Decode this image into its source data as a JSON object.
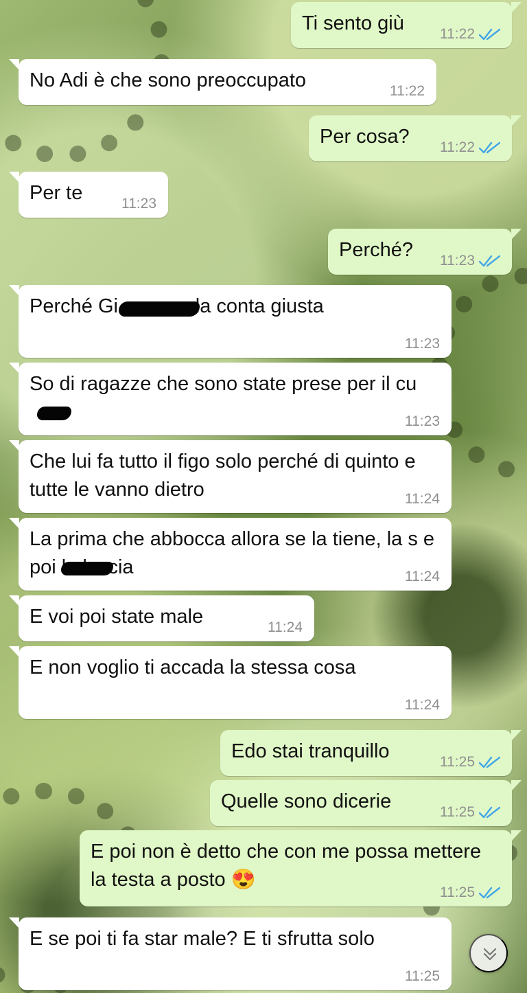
{
  "colors": {
    "incoming_bubble": "#ffffff",
    "outgoing_bubble": "#e0f8c7",
    "read_ticks": "#43a6e8",
    "timestamp": "#8f8f8f"
  },
  "messages": [
    {
      "direction": "out",
      "text": "Ti sento giù",
      "time": "11:22",
      "status": "read-ticks-icon"
    },
    {
      "direction": "in",
      "text": "No Adi è che sono preoccupato",
      "time": "11:22"
    },
    {
      "direction": "out",
      "text": "Per cosa?",
      "time": "11:22",
      "status": "read-ticks-icon"
    },
    {
      "direction": "in",
      "text": "Per te",
      "time": "11:23"
    },
    {
      "direction": "out",
      "text": "Perché?",
      "time": "11:23",
      "status": "read-ticks-icon"
    },
    {
      "direction": "in",
      "text": "Perché Gi non me la conta giusta",
      "time": "11:23"
    },
    {
      "direction": "in",
      "text": "So di ragazze che sono state prese per il cu",
      "time": "11:23"
    },
    {
      "direction": "in",
      "text": "Che lui fa tutto il figo solo perché di quinto e tutte le vanno dietro",
      "time": "11:24"
    },
    {
      "direction": "in",
      "text": "La prima che abbocca allora se la tiene, la s e poi la lascia",
      "time": "11:24"
    },
    {
      "direction": "in",
      "text": "E voi poi state male",
      "time": "11:24"
    },
    {
      "direction": "in",
      "text": "E non voglio ti accada la stessa cosa",
      "time": "11:24"
    },
    {
      "direction": "out",
      "text": "Edo stai tranquillo",
      "time": "11:25",
      "status": "read-ticks-icon"
    },
    {
      "direction": "out",
      "text": "Quelle sono dicerie",
      "time": "11:25",
      "status": "read-ticks-icon"
    },
    {
      "direction": "out",
      "text": "E poi non è detto che con me possa mettere la testa a posto 😍",
      "time": "11:25",
      "status": "read-ticks-icon"
    },
    {
      "direction": "in",
      "text": "E se poi ti fa star male? E ti sfrutta solo",
      "time": "11:25"
    }
  ],
  "scroll_button": {
    "icon": "double-chevron-down-icon"
  }
}
